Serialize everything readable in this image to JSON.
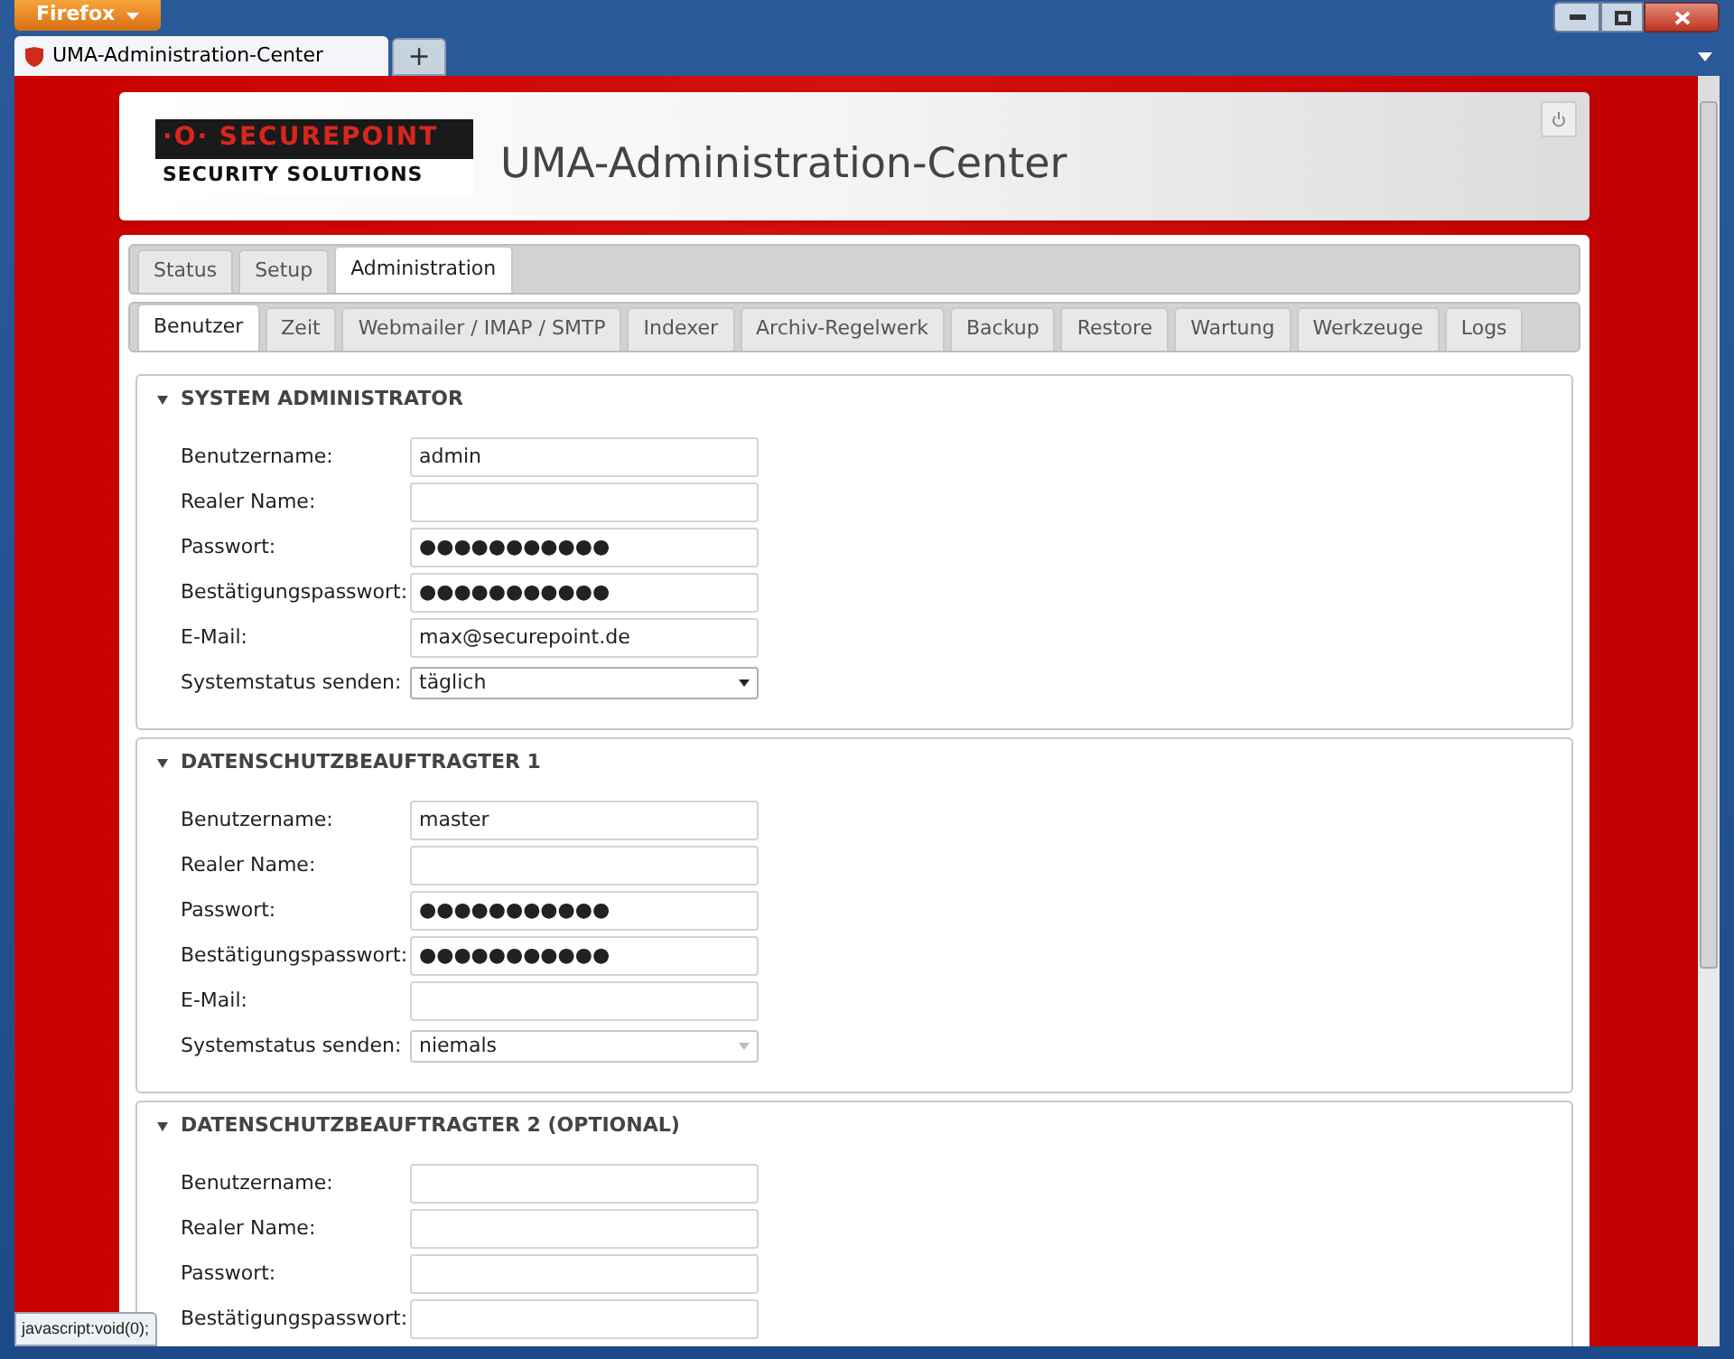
{
  "browser": {
    "menu_button": "Firefox",
    "tabs": [
      {
        "title": "UMA-Administration-Center",
        "selected": true
      }
    ],
    "new_tab": "+"
  },
  "header": {
    "logo_top": "·O· SECUREPOINT",
    "logo_bottom": "SECURITY SOLUTIONS",
    "title": "UMA-Administration-Center"
  },
  "main_tabs": [
    {
      "label": "Status",
      "selected": false
    },
    {
      "label": "Setup",
      "selected": false
    },
    {
      "label": "Administration",
      "selected": true
    }
  ],
  "sub_tabs": [
    {
      "label": "Benutzer",
      "selected": true
    },
    {
      "label": "Zeit",
      "selected": false
    },
    {
      "label": "Webmailer / IMAP / SMTP",
      "selected": false
    },
    {
      "label": "Indexer",
      "selected": false
    },
    {
      "label": "Archiv-Regelwerk",
      "selected": false
    },
    {
      "label": "Backup",
      "selected": false
    },
    {
      "label": "Restore",
      "selected": false
    },
    {
      "label": "Wartung",
      "selected": false
    },
    {
      "label": "Werkzeuge",
      "selected": false
    },
    {
      "label": "Logs",
      "selected": false
    }
  ],
  "sections": [
    {
      "title": "SYSTEM ADMINISTRATOR",
      "expanded": true,
      "fields": [
        {
          "kind": "text",
          "label": "Benutzername:",
          "value": "admin"
        },
        {
          "kind": "text",
          "label": "Realer Name:"
        },
        {
          "kind": "password",
          "label": "Passwort:",
          "value": "●●●●●●●●●●●"
        },
        {
          "kind": "password",
          "label": "Bestätigungspasswort:",
          "value": "●●●●●●●●●●●"
        },
        {
          "kind": "text",
          "label": "E-Mail:",
          "value": "max@securepoint.de"
        },
        {
          "kind": "select",
          "label": "Systemstatus senden:",
          "value": "täglich",
          "disabled": false
        }
      ]
    },
    {
      "title": "DATENSCHUTZBEAUFTRAGTER 1",
      "expanded": true,
      "fields": [
        {
          "kind": "text",
          "label": "Benutzername:",
          "value": "master"
        },
        {
          "kind": "text",
          "label": "Realer Name:"
        },
        {
          "kind": "password",
          "label": "Passwort:",
          "value": "●●●●●●●●●●●"
        },
        {
          "kind": "password",
          "label": "Bestätigungspasswort:",
          "value": "●●●●●●●●●●●"
        },
        {
          "kind": "text",
          "label": "E-Mail:"
        },
        {
          "kind": "select",
          "label": "Systemstatus senden:",
          "value": "niemals",
          "disabled": true
        }
      ]
    },
    {
      "title": "DATENSCHUTZBEAUFTRAGTER 2 (OPTIONAL)",
      "expanded": true,
      "fields": [
        {
          "kind": "text",
          "label": "Benutzername:"
        },
        {
          "kind": "text",
          "label": "Realer Name:"
        },
        {
          "kind": "password",
          "label": "Passwort:"
        },
        {
          "kind": "password",
          "label": "Bestätigungspasswort:"
        }
      ]
    }
  ],
  "status_text": "javascript:void(0);"
}
